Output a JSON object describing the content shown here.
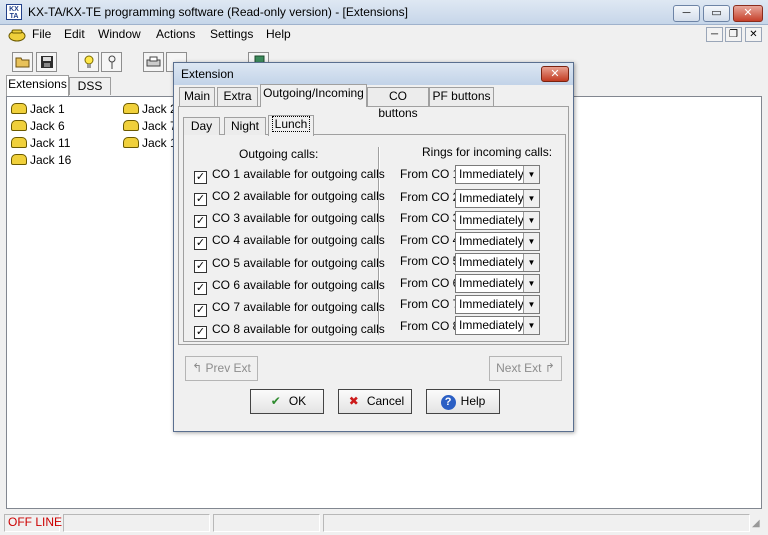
{
  "window": {
    "title": "KX-TA/KX-TE programming software (Read-only version) - [Extensions]",
    "app_icon": "KX TA"
  },
  "window_controls": {
    "minimize": "─",
    "maximize": "▭",
    "close": "✕"
  },
  "menu": {
    "items": [
      "File",
      "Edit",
      "Window",
      "Actions",
      "Settings",
      "Help"
    ]
  },
  "mdi_controls": {
    "minimize": "─",
    "restore": "❐",
    "close": "✕"
  },
  "toolbar": {
    "open_icon": "folder-icon",
    "save_icon": "floppy-icon",
    "light_icon": "bulb-icon",
    "key_icon": "key-icon",
    "print_icon": "printer-icon",
    "copy_icon": "copy-icon",
    "exit_icon": "exit-door-icon"
  },
  "panel_tabs": [
    "Extensions",
    "DSS"
  ],
  "extensions": {
    "col1": [
      "Jack 1",
      "Jack 6",
      "Jack 11",
      "Jack 16"
    ],
    "col2": [
      "Jack 2",
      "Jack 7",
      "Jack 1"
    ]
  },
  "statusbar": {
    "status": "OFF LINE"
  },
  "dialog": {
    "title": "Extension",
    "close": "✕",
    "tabs": [
      "Main",
      "Extra",
      "Outgoing/Incoming",
      "CO buttons",
      "PF buttons"
    ],
    "active_tab": "Outgoing/Incoming",
    "subtabs": [
      "Day",
      "Night",
      "Lunch"
    ],
    "active_subtab": "Lunch",
    "outgoing_header": "Outgoing calls:",
    "incoming_header": "Rings for incoming calls:",
    "outgoing": [
      {
        "label": "CO 1 available for outgoing calls",
        "checked": "✓"
      },
      {
        "label": "CO 2 available for outgoing calls",
        "checked": "✓"
      },
      {
        "label": "CO 3 available for outgoing calls",
        "checked": "✓"
      },
      {
        "label": "CO 4 available for outgoing calls",
        "checked": "✓"
      },
      {
        "label": "CO 5 available for outgoing calls",
        "checked": "✓"
      },
      {
        "label": "CO 6 available for outgoing calls",
        "checked": "✓"
      },
      {
        "label": "CO 7 available for outgoing calls",
        "checked": "✓"
      },
      {
        "label": "CO 8 available for outgoing calls",
        "checked": "✓"
      }
    ],
    "incoming": [
      {
        "label": "From CO 1:",
        "value": "Immediately"
      },
      {
        "label": "From CO 2:",
        "value": "Immediately"
      },
      {
        "label": "From CO 3:",
        "value": "Immediately"
      },
      {
        "label": "From CO 4:",
        "value": "Immediately"
      },
      {
        "label": "From CO 5:",
        "value": "Immediately"
      },
      {
        "label": "From CO 6:",
        "value": "Immediately"
      },
      {
        "label": "From CO 7:",
        "value": "Immediately"
      },
      {
        "label": "From CO 8:",
        "value": "Immediately"
      }
    ],
    "dropdown_arrow": "▼",
    "prev_ext": "Prev Ext",
    "next_ext": "Next Ext",
    "ok": "OK",
    "cancel": "Cancel",
    "help": "Help",
    "ok_icon": "✔",
    "cancel_icon": "✖",
    "help_icon": "?"
  }
}
